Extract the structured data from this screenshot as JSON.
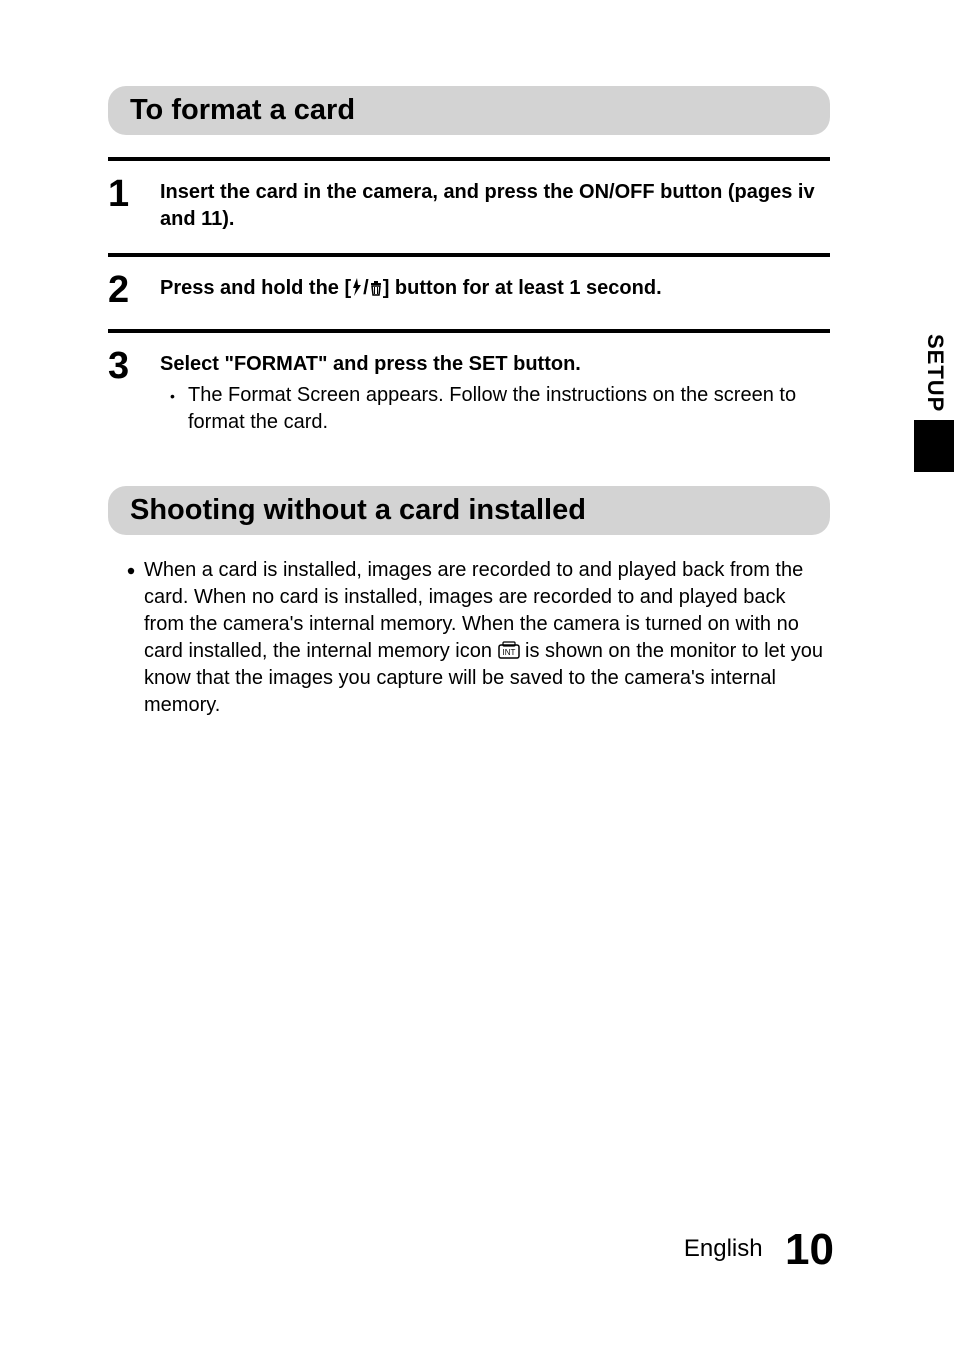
{
  "section1": {
    "heading": "To format a card",
    "steps": [
      {
        "num": "1",
        "title": "Insert the card in the camera, and press the ON/OFF button (pages iv and 11)."
      },
      {
        "num": "2",
        "title_before": "Press and hold the [",
        "title_after": "] button for at least 1 second."
      },
      {
        "num": "3",
        "title": "Select \"FORMAT\" and press the SET button.",
        "sub": "The Format Screen appears. Follow the instructions on the screen to format the card."
      }
    ]
  },
  "section2": {
    "heading": "Shooting without a card installed",
    "para_before": "When a card is installed, images are recorded to and played back from the card. When no card is installed, images are recorded to and played back from the camera's internal memory. When the camera is turned on with no card installed, the internal memory icon ",
    "para_after": " is shown on the monitor to let you know that the images you capture will be saved to the camera's internal memory."
  },
  "side_tab": "SETUP",
  "footer": {
    "language": "English",
    "page": "10"
  }
}
